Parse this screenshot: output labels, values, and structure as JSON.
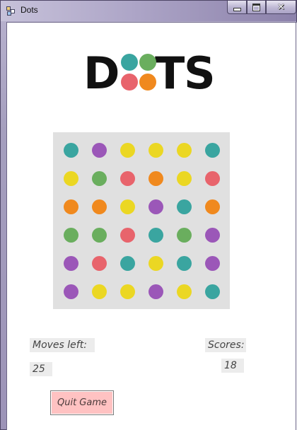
{
  "window": {
    "title": "Dots",
    "close_glyph": "✕"
  },
  "logo": {
    "letter_d": "D",
    "letter_t": "T",
    "letter_s": "S",
    "dot_colors": [
      "#3aa5a0",
      "#6aae5e",
      "#e8646c",
      "#f0891e"
    ]
  },
  "colors": {
    "teal": "#3aa5a0",
    "purple": "#9b57b8",
    "yellow": "#ebd723",
    "green": "#6aae5e",
    "red": "#e8646c",
    "orange": "#f0891e",
    "board_bg": "#e0e0e0",
    "quit_bg": "#ffc2c2"
  },
  "board": {
    "rows": [
      [
        "teal",
        "purple",
        "yellow",
        "yellow",
        "yellow",
        "teal"
      ],
      [
        "yellow",
        "green",
        "red",
        "orange",
        "yellow",
        "red"
      ],
      [
        "orange",
        "orange",
        "yellow",
        "purple",
        "teal",
        "orange"
      ],
      [
        "green",
        "green",
        "red",
        "teal",
        "green",
        "purple"
      ],
      [
        "purple",
        "red",
        "teal",
        "yellow",
        "teal",
        "purple"
      ],
      [
        "purple",
        "yellow",
        "yellow",
        "purple",
        "yellow",
        "teal"
      ]
    ]
  },
  "stats": {
    "moves_label": "Moves left:",
    "moves_value": "25",
    "scores_label": "Scores:",
    "scores_value": "18"
  },
  "actions": {
    "quit_label": "Quit Game"
  }
}
